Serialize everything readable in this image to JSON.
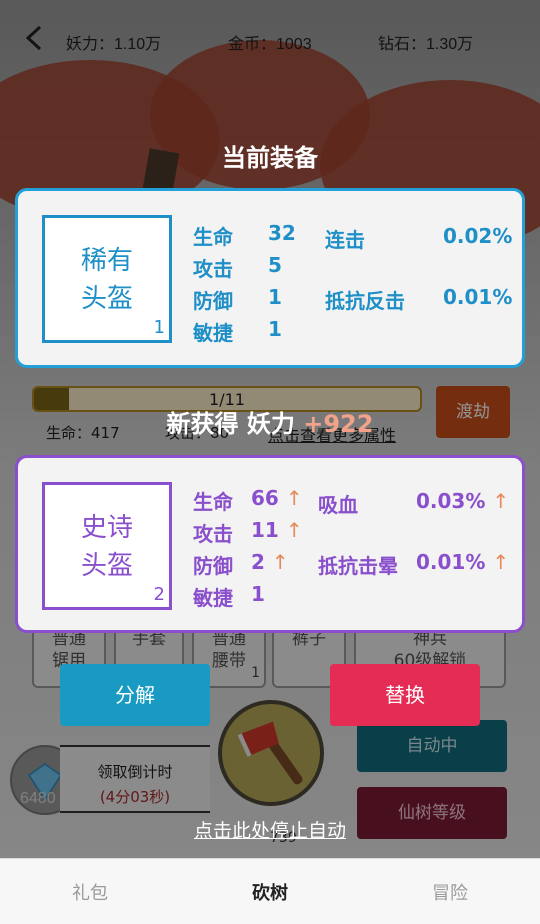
{
  "topbar": {
    "power": "妖力：1.10万",
    "gold": "金币：1003",
    "diamond": "钻石：1.30万"
  },
  "progress": {
    "text": "1/11",
    "fraction": 0.09
  },
  "dujie_label": "渡劫",
  "player_stats": {
    "hp": "生命：417",
    "atk": "攻击：80",
    "more": "点击查看更多属性"
  },
  "equipment_grid": [
    {
      "label": "普通\n锯用",
      "num": ""
    },
    {
      "label": "手套",
      "num": ""
    },
    {
      "label": "普通\n腰带",
      "num": "1"
    },
    {
      "label": "裤子",
      "num": ""
    },
    {
      "label": "神兵\n60级解锁",
      "num": ""
    }
  ],
  "overlay": {
    "current_title": "当前装备",
    "new_title_prefix": "新获得 妖力",
    "new_title_value": "+922"
  },
  "current_item": {
    "name_line1": "稀有",
    "name_line2": "头盔",
    "level": "1",
    "stats": [
      {
        "label": "生命",
        "value": "32"
      },
      {
        "label": "攻击",
        "value": "5"
      },
      {
        "label": "防御",
        "value": "1"
      },
      {
        "label": "敏捷",
        "value": "1"
      }
    ],
    "extra": [
      {
        "label": "连击",
        "value": "0.02%"
      },
      {
        "label": "抵抗反击",
        "value": "0.01%"
      }
    ]
  },
  "new_item": {
    "name_line1": "史诗",
    "name_line2": "头盔",
    "level": "2",
    "arrow": "↑",
    "stats": [
      {
        "label": "生命",
        "value": "66"
      },
      {
        "label": "攻击",
        "value": "11"
      },
      {
        "label": "防御",
        "value": "2"
      },
      {
        "label": "敏捷",
        "value": "1"
      }
    ],
    "extra": [
      {
        "label": "吸血",
        "value": "0.03%"
      },
      {
        "label": "抵抗击晕",
        "value": "0.01%"
      }
    ]
  },
  "actions": {
    "decompose": "分解",
    "replace": "替换"
  },
  "bottom_area": {
    "gem_count": "6480",
    "countdown_title": "领取倒计时",
    "countdown_time": "(4分03秒)",
    "auto_label": "自动中",
    "tree_level_label": "仙树等级",
    "stop_auto": "点击此处停止自动",
    "chop_count": "739"
  },
  "nav": {
    "gift": "礼包",
    "chop": "砍树",
    "adventure": "冒险"
  }
}
